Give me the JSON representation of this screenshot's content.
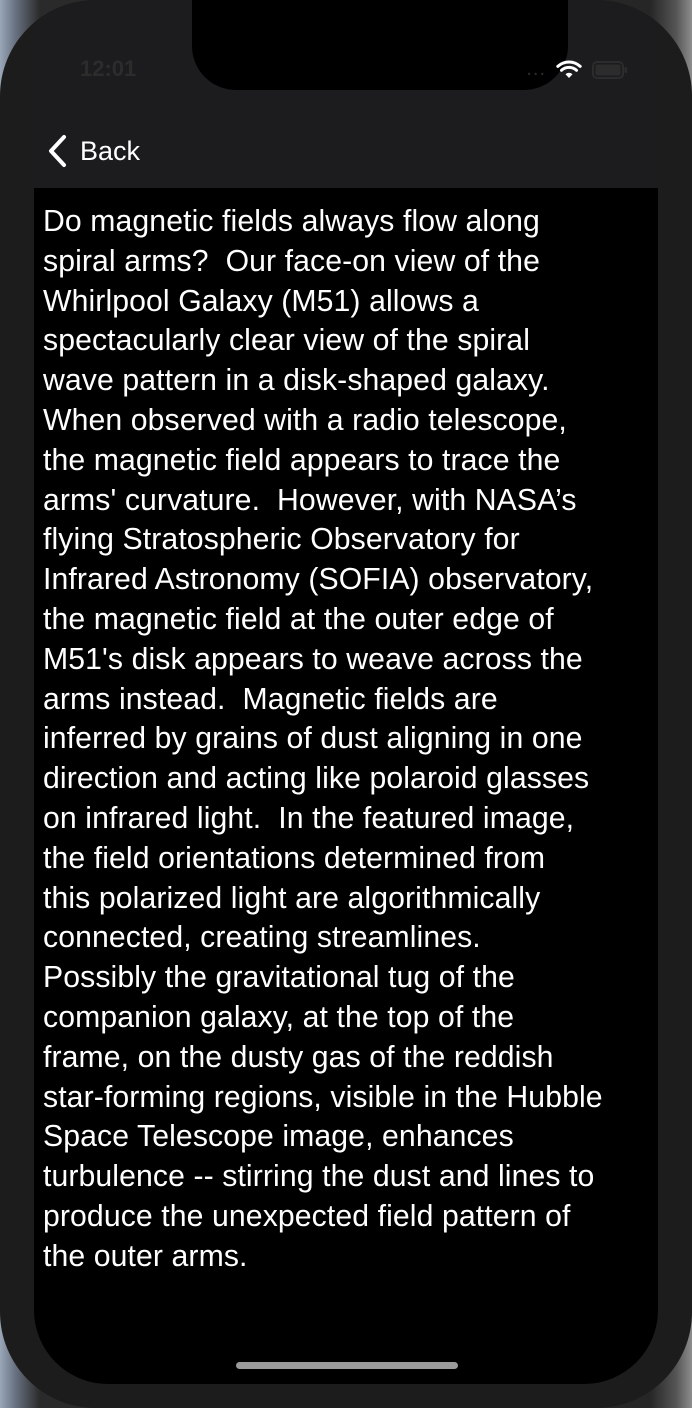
{
  "status_bar": {
    "time": "12:01",
    "signal": "...",
    "wifi_icon": "wifi-icon",
    "battery_icon": "battery-icon"
  },
  "nav": {
    "back_label": "Back",
    "back_icon": "chevron-left-icon"
  },
  "description": {
    "lines": [
      "Do magnetic fields always flow along",
      "spiral arms?  Our face-on view of the",
      "Whirlpool Galaxy (M51) allows a",
      "spectacularly clear view of the spiral",
      "wave pattern in a disk-shaped galaxy.",
      "When observed with a radio telescope,",
      "the magnetic field appears to trace the",
      "arms' curvature.  However, with NASA’s",
      "flying Stratospheric Observatory for",
      "Infrared Astronomy (SOFIA) observatory,",
      "the magnetic field at the outer edge of",
      "M51's disk appears to weave across the",
      "arms instead.  Magnetic fields are",
      "inferred by grains of dust aligning in one",
      "direction and acting like polaroid glasses",
      "on infrared light.  In the featured image,",
      "the field orientations determined from",
      "this polarized light are algorithmically",
      "connected, creating streamlines.",
      "Possibly the gravitational tug of the",
      "companion galaxy, at the top of the",
      "frame, on the dusty gas of the reddish",
      "star-forming regions, visible in the Hubble",
      "Space Telescope image, enhances",
      "turbulence -- stirring the dust and lines to",
      "produce the unexpected field pattern of",
      "the outer arms."
    ]
  }
}
